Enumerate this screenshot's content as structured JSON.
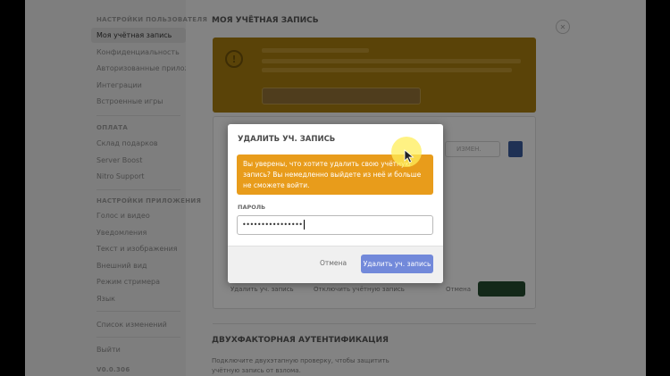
{
  "sidebar": {
    "header_user_settings": "Настройки пользователя",
    "items_user": [
      {
        "label": "Моя учётная запись",
        "active": true
      },
      {
        "label": "Конфиденциальность"
      },
      {
        "label": "Авторизованные приложения"
      },
      {
        "label": "Интеграции"
      },
      {
        "label": "Встроенные игры"
      }
    ],
    "header_billing": "Оплата",
    "items_billing": [
      {
        "label": "Склад подарков"
      },
      {
        "label": "Server Boost"
      },
      {
        "label": "Nitro Support"
      }
    ],
    "header_app_settings": "Настройки приложения",
    "items_app": [
      {
        "label": "Голос и видео"
      },
      {
        "label": "Уведомления"
      },
      {
        "label": "Текст и изображения"
      },
      {
        "label": "Внешний вид"
      },
      {
        "label": "Режим стримера"
      },
      {
        "label": "Язык"
      }
    ],
    "change_log": "Список изменений",
    "logout": "Выйти",
    "version": "v0.0.306"
  },
  "main": {
    "title": "Моя учётная запись",
    "card_links": [
      "Удалить уч. запись",
      "Отключить учётную запись",
      "Отмена"
    ],
    "card_field_text": "ИЗМЕН.",
    "section2_title": "Двухфакторная аутентификация",
    "section2_line1": "Подключите двухэтапную проверку, чтобы защитить",
    "section2_line2": "учётную запись от взлома."
  },
  "modal": {
    "title": "Удалить уч. запись",
    "warning": "Вы уверены, что хотите удалить свою учётную запись? Вы немедленно выйдете из неё и больше не сможете войти.",
    "password_label": "Пароль",
    "password_value": "••••••••••••••••",
    "cancel_label": "Отмена",
    "delete_label": "Удалить уч. запись"
  },
  "colors": {
    "warning": "#e89c1b",
    "primary": "#7289da",
    "banner": "#a47a10",
    "success": "#244a2f"
  },
  "icons": {
    "warning": "alert-circle-icon",
    "close": "close-icon",
    "cursor": "mouse-pointer-icon"
  }
}
